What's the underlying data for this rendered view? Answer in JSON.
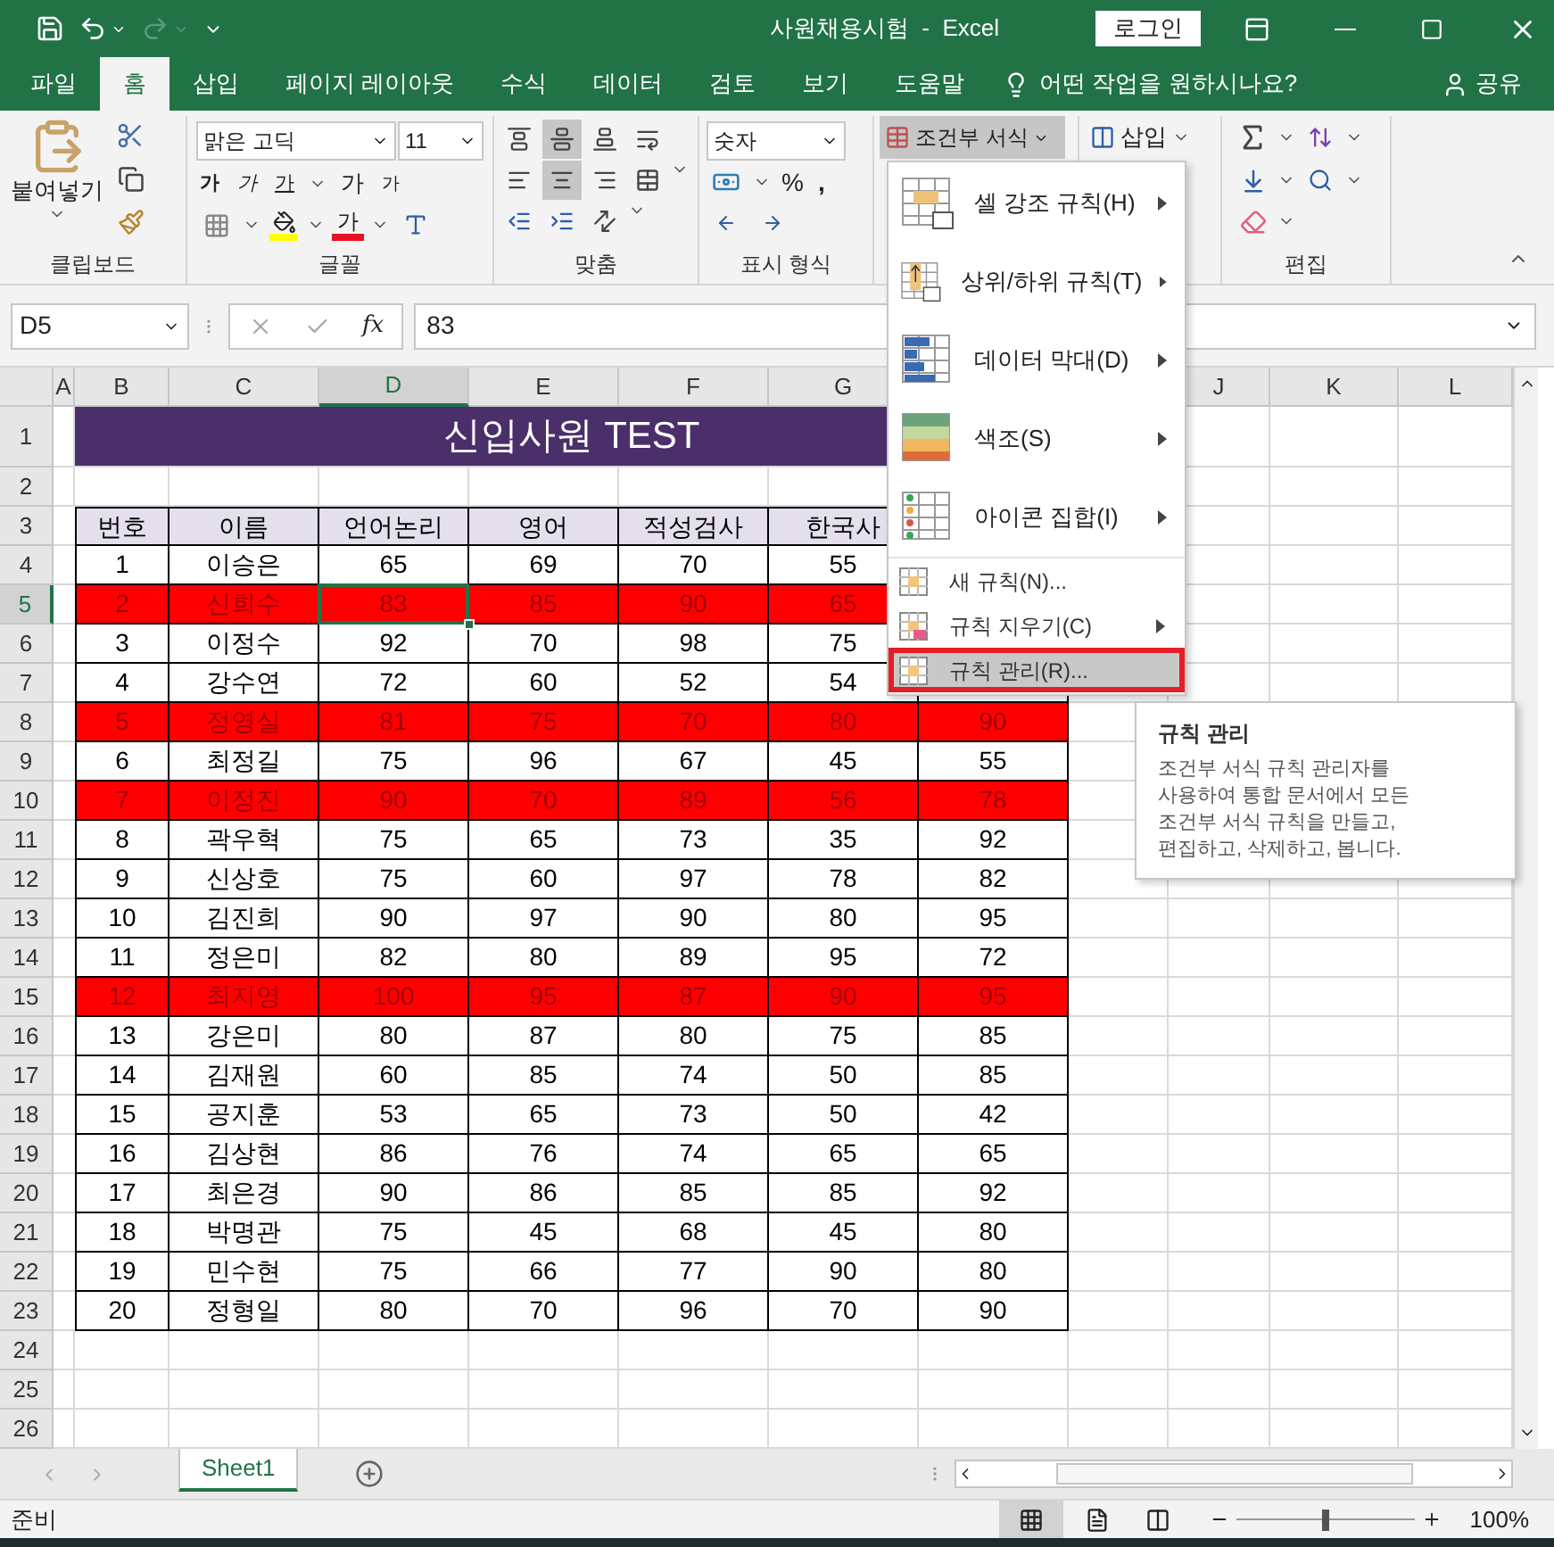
{
  "window": {
    "title": "사원채용시험  -  Excel",
    "login_button": "로그인"
  },
  "ribbon_tabs": [
    {
      "label": "파일",
      "selected": false
    },
    {
      "label": "홈",
      "selected": true
    },
    {
      "label": "삽입",
      "selected": false
    },
    {
      "label": "페이지 레이아웃",
      "selected": false
    },
    {
      "label": "수식",
      "selected": false
    },
    {
      "label": "데이터",
      "selected": false
    },
    {
      "label": "검토",
      "selected": false
    },
    {
      "label": "보기",
      "selected": false
    },
    {
      "label": "도움말",
      "selected": false
    }
  ],
  "tell_me": "어떤 작업을 원하시나요?",
  "share": "공유",
  "ribbon": {
    "paste": "붙여넣기",
    "font_name": "맑은 고딕",
    "font_size": "11",
    "bold": "가",
    "italic": "가",
    "underline": "가",
    "grow": "가",
    "shrink": "가",
    "font_color": "가",
    "number_format": "숫자",
    "percent": "%",
    "comma": ",",
    "conditional_format": {
      "label": "조건부 서식",
      "pressed": true
    },
    "insert": "삽입",
    "groups": [
      "클립보드",
      "글꼴",
      "맞춤",
      "표시 형식",
      "편집"
    ]
  },
  "formula_bar": {
    "name_box": "D5",
    "fx": "fx",
    "value": "83"
  },
  "columns": [
    {
      "label": "A",
      "selected": false
    },
    {
      "label": "B",
      "selected": false
    },
    {
      "label": "C",
      "selected": false
    },
    {
      "label": "D",
      "selected": true
    },
    {
      "label": "E",
      "selected": false
    },
    {
      "label": "F",
      "selected": false
    },
    {
      "label": "G",
      "selected": false
    },
    {},
    {},
    {
      "label": "J",
      "selected": false
    },
    {
      "label": "K",
      "selected": false
    },
    {
      "label": "L",
      "selected": false
    }
  ],
  "rows": [
    {
      "number": "1",
      "kind": "title",
      "selected": false,
      "title": "신입사원 TEST"
    },
    {
      "number": "2",
      "kind": "empty",
      "selected": false
    },
    {
      "number": "3",
      "kind": "header",
      "selected": false,
      "cells": [
        "번호",
        "이름",
        "언어논리",
        "영어",
        "적성검사",
        "한국사"
      ]
    },
    {
      "number": "4",
      "kind": "data",
      "selected": false,
      "highlighted": false,
      "cells": [
        "1",
        "이승은",
        "65",
        "69",
        "70",
        "55"
      ]
    },
    {
      "number": "5",
      "kind": "data",
      "selected": true,
      "highlighted": true,
      "cells": [
        "2",
        "신희수",
        "83",
        "85",
        "90",
        "65"
      ]
    },
    {
      "number": "6",
      "kind": "data",
      "selected": false,
      "highlighted": false,
      "cells": [
        "3",
        "이정수",
        "92",
        "70",
        "98",
        "75"
      ]
    },
    {
      "number": "7",
      "kind": "data",
      "selected": false,
      "highlighted": false,
      "cells": [
        "4",
        "강수연",
        "72",
        "60",
        "52",
        "54"
      ]
    },
    {
      "number": "8",
      "kind": "data",
      "selected": false,
      "highlighted": true,
      "cells": [
        "5",
        "정영실",
        "81",
        "75",
        "70",
        "80",
        "90"
      ]
    },
    {
      "number": "9",
      "kind": "data",
      "selected": false,
      "highlighted": false,
      "cells": [
        "6",
        "최정길",
        "75",
        "96",
        "67",
        "45",
        "55"
      ]
    },
    {
      "number": "10",
      "kind": "data",
      "selected": false,
      "highlighted": true,
      "cells": [
        "7",
        "이정진",
        "90",
        "70",
        "89",
        "56",
        "78"
      ]
    },
    {
      "number": "11",
      "kind": "data",
      "selected": false,
      "highlighted": false,
      "cells": [
        "8",
        "곽우혁",
        "75",
        "65",
        "73",
        "35",
        "92"
      ]
    },
    {
      "number": "12",
      "kind": "data",
      "selected": false,
      "highlighted": false,
      "cells": [
        "9",
        "신상호",
        "75",
        "60",
        "97",
        "78",
        "82"
      ]
    },
    {
      "number": "13",
      "kind": "data",
      "selected": false,
      "highlighted": false,
      "cells": [
        "10",
        "김진희",
        "90",
        "97",
        "90",
        "80",
        "95"
      ]
    },
    {
      "number": "14",
      "kind": "data",
      "selected": false,
      "highlighted": false,
      "cells": [
        "11",
        "정은미",
        "82",
        "80",
        "89",
        "95",
        "72"
      ]
    },
    {
      "number": "15",
      "kind": "data",
      "selected": false,
      "highlighted": true,
      "cells": [
        "12",
        "최지영",
        "100",
        "95",
        "87",
        "90",
        "95"
      ]
    },
    {
      "number": "16",
      "kind": "data",
      "selected": false,
      "highlighted": false,
      "cells": [
        "13",
        "강은미",
        "80",
        "87",
        "80",
        "75",
        "85"
      ]
    },
    {
      "number": "17",
      "kind": "data",
      "selected": false,
      "highlighted": false,
      "cells": [
        "14",
        "김재원",
        "60",
        "85",
        "74",
        "50",
        "85"
      ]
    },
    {
      "number": "18",
      "kind": "data",
      "selected": false,
      "highlighted": false,
      "cells": [
        "15",
        "공지훈",
        "53",
        "65",
        "73",
        "50",
        "42"
      ]
    },
    {
      "number": "19",
      "kind": "data",
      "selected": false,
      "highlighted": false,
      "cells": [
        "16",
        "김상현",
        "86",
        "76",
        "74",
        "65",
        "65"
      ]
    },
    {
      "number": "20",
      "kind": "data",
      "selected": false,
      "highlighted": false,
      "cells": [
        "17",
        "최은경",
        "90",
        "86",
        "85",
        "85",
        "92"
      ]
    },
    {
      "number": "21",
      "kind": "data",
      "selected": false,
      "highlighted": false,
      "cells": [
        "18",
        "박명관",
        "75",
        "45",
        "68",
        "45",
        "80"
      ]
    },
    {
      "number": "22",
      "kind": "data",
      "selected": false,
      "highlighted": false,
      "cells": [
        "19",
        "민수현",
        "75",
        "66",
        "77",
        "90",
        "80"
      ]
    },
    {
      "number": "23",
      "kind": "data",
      "selected": false,
      "highlighted": false,
      "cells": [
        "20",
        "정형일",
        "80",
        "70",
        "96",
        "70",
        "90"
      ]
    },
    {
      "number": "24",
      "kind": "empty",
      "selected": false
    },
    {
      "number": "25",
      "kind": "empty",
      "selected": false
    },
    {
      "number": "26",
      "kind": "empty",
      "selected": false
    }
  ],
  "menu": {
    "items": [
      {
        "kind": "large",
        "label": "셀 강조 규칙(H)",
        "submenu": true,
        "selected": false
      },
      {
        "kind": "large",
        "label": "상위/하위 규칙(T)",
        "submenu": true,
        "selected": false
      },
      {
        "kind": "large",
        "label": "데이터 막대(D)",
        "submenu": true,
        "selected": false
      },
      {
        "kind": "large",
        "label": "색조(S)",
        "submenu": true,
        "selected": false
      },
      {
        "kind": "large",
        "label": "아이콘 집합(I)",
        "submenu": true,
        "selected": false
      },
      {
        "kind": "small",
        "label": "새 규칙(N)...",
        "submenu": false,
        "selected": false
      },
      {
        "kind": "small",
        "label": "규칙 지우기(C)",
        "submenu": true,
        "selected": false
      },
      {
        "kind": "small",
        "label": "규칙 관리(R)...",
        "submenu": false,
        "selected": true
      }
    ]
  },
  "tooltip": {
    "title": "규칙 관리",
    "body": "조건부 서식 규칙 관리자를\n사용하여 통합 문서에서 모든\n조건부 서식 규칙을 만들고,\n편집하고, 삭제하고, 봅니다."
  },
  "sheet_tabs": [
    {
      "label": "Sheet1",
      "selected": true
    }
  ],
  "status": {
    "text": "준비",
    "zoom": "100%",
    "level": 0.5
  }
}
